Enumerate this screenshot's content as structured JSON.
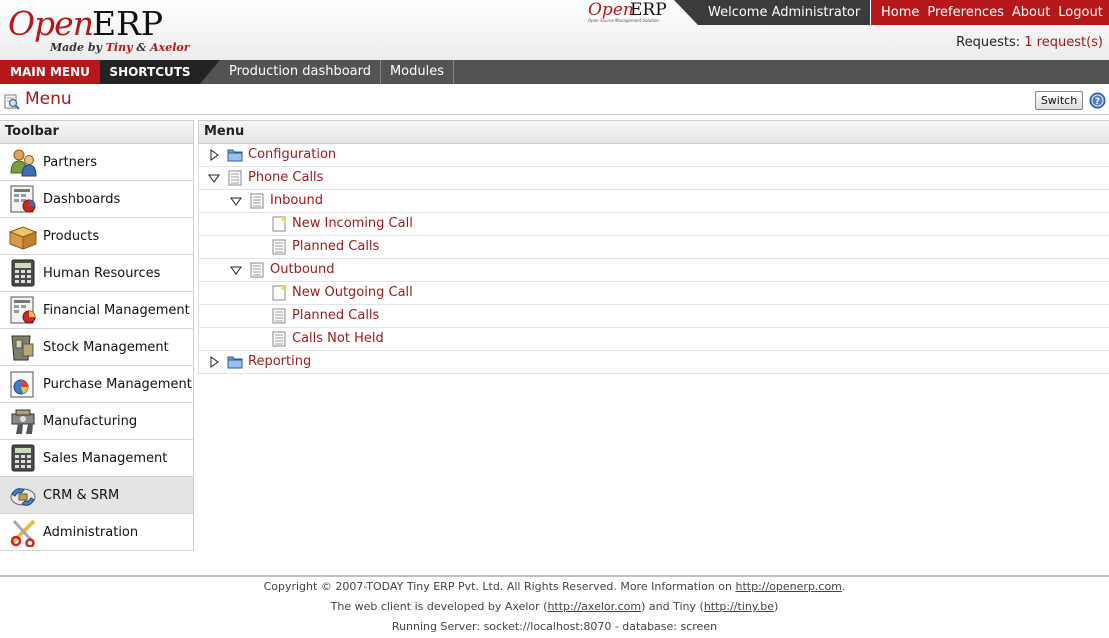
{
  "header": {
    "logo_open": "Open",
    "logo_erp": "ERP",
    "logo_tagline_prefix": "Made by ",
    "logo_tagline_tiny": "Tiny",
    "logo_tagline_amp": " & ",
    "logo_tagline_axelor": "Axelor",
    "small_logo_open": "Open",
    "small_logo_erp": "ERP",
    "small_logo_sub": "Open Source Management Solution",
    "welcome": "Welcome Administrator",
    "links": [
      "Home",
      "Preferences",
      "About",
      "Logout"
    ],
    "requests_label": "Requests:",
    "requests_link": "1 request(s)"
  },
  "nav": {
    "main_menu": "MAIN MENU",
    "shortcuts": "SHORTCUTS",
    "shortcut_items": [
      "Production dashboard",
      "Modules"
    ]
  },
  "page": {
    "title": "Menu",
    "switch_label": "Switch"
  },
  "toolbar": {
    "heading": "Toolbar",
    "items": [
      {
        "label": "Partners",
        "icon": "partners-icon"
      },
      {
        "label": "Dashboards",
        "icon": "dashboards-icon"
      },
      {
        "label": "Products",
        "icon": "products-icon"
      },
      {
        "label": "Human Resources",
        "icon": "human-resources-icon"
      },
      {
        "label": "Financial Management",
        "icon": "financial-management-icon"
      },
      {
        "label": "Stock Management",
        "icon": "stock-management-icon"
      },
      {
        "label": "Purchase Management",
        "icon": "purchase-management-icon"
      },
      {
        "label": "Manufacturing",
        "icon": "manufacturing-icon"
      },
      {
        "label": "Sales Management",
        "icon": "sales-management-icon"
      },
      {
        "label": "CRM & SRM",
        "icon": "crm-srm-icon",
        "active": true
      },
      {
        "label": "Administration",
        "icon": "administration-icon"
      }
    ]
  },
  "menu": {
    "heading": "Menu",
    "rows": [
      {
        "label": "Configuration",
        "level": 0,
        "expander": "collapsed",
        "icon": "folder"
      },
      {
        "label": "Phone Calls",
        "level": 0,
        "expander": "expanded",
        "icon": "list"
      },
      {
        "label": "Inbound",
        "level": 1,
        "expander": "expanded",
        "icon": "list"
      },
      {
        "label": "New Incoming Call",
        "level": 2,
        "expander": "none",
        "icon": "form"
      },
      {
        "label": "Planned Calls",
        "level": 2,
        "expander": "none",
        "icon": "list"
      },
      {
        "label": "Outbound",
        "level": 1,
        "expander": "expanded",
        "icon": "list"
      },
      {
        "label": "New Outgoing Call",
        "level": 2,
        "expander": "none",
        "icon": "form"
      },
      {
        "label": "Planned Calls",
        "level": 2,
        "expander": "none",
        "icon": "list"
      },
      {
        "label": "Calls Not Held",
        "level": 2,
        "expander": "none",
        "icon": "list"
      },
      {
        "label": "Reporting",
        "level": 0,
        "expander": "collapsed",
        "icon": "folder"
      }
    ]
  },
  "footer": {
    "line1_text": "Copyright © 2007-TODAY Tiny ERP Pvt. Ltd. All Rights Reserved. More Information on ",
    "line1_link": "http://openerp.com",
    "line1_end": ".",
    "line2_text_a": "The web client is developed by Axelor (",
    "line2_link_a": "http://axelor.com",
    "line2_text_b": ") and Tiny (",
    "line2_link_b": "http://tiny.be",
    "line2_text_c": ")",
    "line3": "Running Server: socket://localhost:8070 - database: screen"
  },
  "colors": {
    "brand_red": "#b5181b",
    "link_red": "#9b1a1a",
    "dark_bar": "#3b3b3b",
    "nav_gray": "#535353"
  }
}
